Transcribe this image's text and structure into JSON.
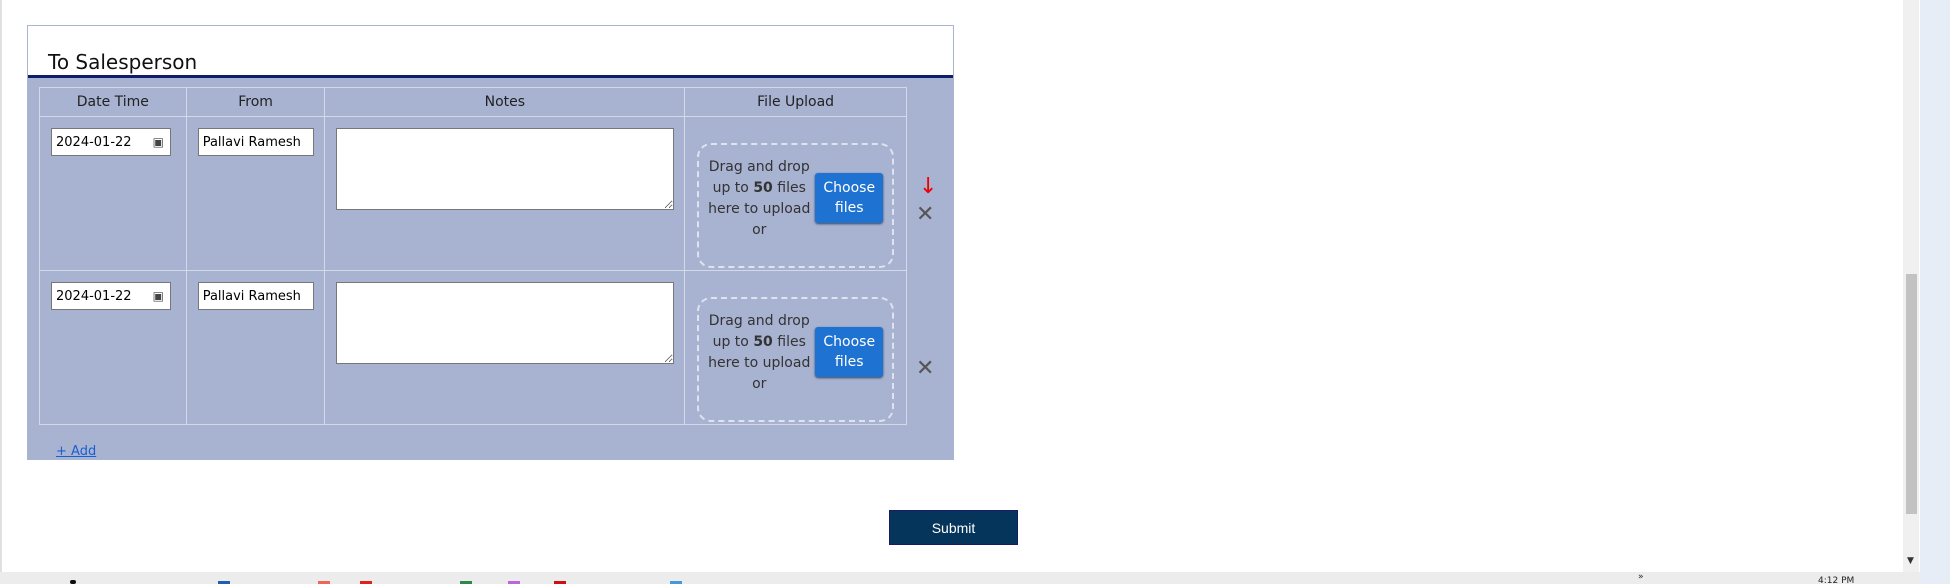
{
  "section": {
    "title": "To Salesperson"
  },
  "table": {
    "headers": [
      "Date Time",
      "From",
      "Notes",
      "File Upload"
    ],
    "rows": [
      {
        "date": "2024-01-22",
        "from": "Pallavi Ramesh",
        "notes": ""
      },
      {
        "date": "2024-01-22",
        "from": "Pallavi Ramesh",
        "notes": ""
      }
    ]
  },
  "upload": {
    "text_pre": "Drag and drop up to ",
    "count": "50",
    "text_post": " files here to upload or",
    "button": "Choose files"
  },
  "add_label": "+ Add",
  "submit_label": "Submit",
  "taskbar": {
    "clock": "4:12 PM",
    "overflow": "»"
  },
  "colors": {
    "panel_bg": "#a8b2d1",
    "accent_line": "#0d1f6b",
    "choose_button": "#1e73d2",
    "submit_button": "#05355a",
    "annotation_arrow": "#e00000"
  }
}
